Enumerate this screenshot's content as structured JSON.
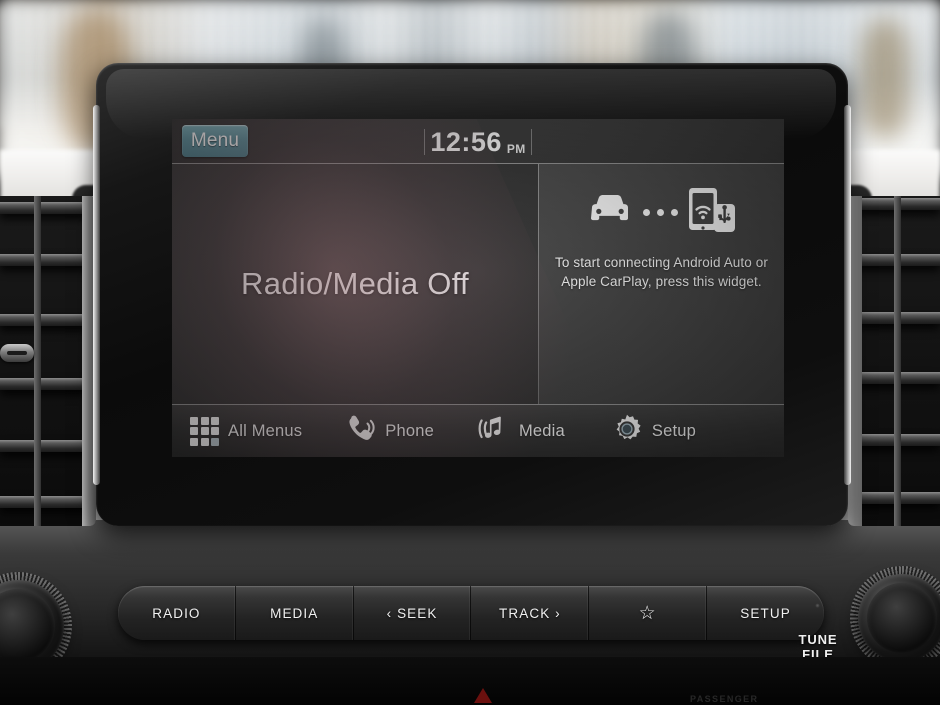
{
  "screen": {
    "status_bar": {
      "menu_label": "Menu",
      "time": "12:56",
      "ampm": "PM"
    },
    "left_pane": {
      "title": "Radio/Media Off"
    },
    "right_widget": {
      "icons": [
        "car-icon",
        "connection-dots",
        "phone-wifi-usb-icon"
      ],
      "text": "To start connecting Android Auto or Apple CarPlay, press this widget."
    },
    "toolbar": [
      {
        "icon": "all-menus-grid-icon",
        "label": "All Menus"
      },
      {
        "icon": "phone-handset-icon",
        "label": "Phone"
      },
      {
        "icon": "media-music-note-icon",
        "label": "Media"
      },
      {
        "icon": "setup-gear-icon",
        "label": "Setup"
      }
    ]
  },
  "hard_buttons": [
    {
      "label": "RADIO",
      "icon": ""
    },
    {
      "label": "MEDIA",
      "icon": ""
    },
    {
      "label": "‹ SEEK",
      "icon": "seek-back-icon"
    },
    {
      "label": "TRACK ›",
      "icon": "track-forward-icon"
    },
    {
      "label": "",
      "icon": "star-favorite-icon"
    },
    {
      "label": "SETUP",
      "icon": ""
    }
  ],
  "knobs": {
    "right_label_line1": "TUNE",
    "right_label_line2": "FILE"
  },
  "colors": {
    "menu_button": "#5f949f",
    "screen_bg": "#343434",
    "text": "#f0f0f0",
    "bezel": "#0b0b0b",
    "hazard": "#7e1310"
  },
  "bottom": {
    "passenger_label": "PASSENGER"
  }
}
